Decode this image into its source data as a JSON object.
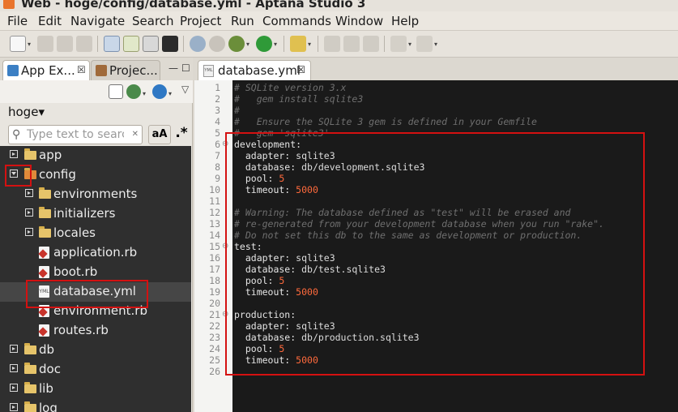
{
  "window": {
    "title": "Web - hoge/config/database.yml - Aptana Studio 3"
  },
  "menu": [
    {
      "label": "File"
    },
    {
      "label": "Edit"
    },
    {
      "label": "Navigate"
    },
    {
      "label": "Search"
    },
    {
      "label": "Project"
    },
    {
      "label": "Run"
    },
    {
      "label": "Commands"
    },
    {
      "label": "Window"
    },
    {
      "label": "Help"
    }
  ],
  "left_tabs": [
    {
      "label": "App Ex...",
      "close": "☒"
    },
    {
      "label": "Projec..."
    }
  ],
  "window_controls": {
    "minimize": "—",
    "maximize": "☐"
  },
  "project_selector": {
    "label": "hoge",
    "arrow": "▾"
  },
  "filter": {
    "placeholder": "Type text to search",
    "aa_label": "aA",
    "regex_label": ".*"
  },
  "tree": [
    {
      "label": "app",
      "type": "folder",
      "state": "collapsed",
      "level": 0
    },
    {
      "label": "config",
      "type": "folder",
      "state": "expanded",
      "level": 0
    },
    {
      "label": "environments",
      "type": "folder",
      "state": "collapsed",
      "level": 1
    },
    {
      "label": "initializers",
      "type": "folder",
      "state": "collapsed",
      "level": 1
    },
    {
      "label": "locales",
      "type": "folder",
      "state": "collapsed",
      "level": 1
    },
    {
      "label": "application.rb",
      "type": "ruby",
      "level": 1
    },
    {
      "label": "boot.rb",
      "type": "ruby",
      "level": 1
    },
    {
      "label": "database.yml",
      "type": "yaml",
      "level": 1,
      "selected": true
    },
    {
      "label": "environment.rb",
      "type": "ruby",
      "level": 1
    },
    {
      "label": "routes.rb",
      "type": "ruby",
      "level": 1
    },
    {
      "label": "db",
      "type": "folder",
      "state": "collapsed",
      "level": 0
    },
    {
      "label": "doc",
      "type": "folder",
      "state": "collapsed",
      "level": 0
    },
    {
      "label": "lib",
      "type": "folder",
      "state": "collapsed",
      "level": 0
    },
    {
      "label": "log",
      "type": "folder",
      "state": "collapsed",
      "level": 0
    }
  ],
  "editor": {
    "tab_label": "database.yml",
    "tab_close": "☒",
    "lines": [
      {
        "n": "1",
        "kind": "comment",
        "text": "# SQLite version 3.x"
      },
      {
        "n": "2",
        "kind": "comment",
        "text": "#   gem install sqlite3"
      },
      {
        "n": "3",
        "kind": "comment",
        "text": "#"
      },
      {
        "n": "4",
        "kind": "comment",
        "text": "#   Ensure the SQLite 3 gem is defined in your Gemfile"
      },
      {
        "n": "5",
        "kind": "comment",
        "text": "#   gem 'sqlite3'"
      },
      {
        "n": "6",
        "kind": "key",
        "text": "development:",
        "fold": "⊖"
      },
      {
        "n": "7",
        "kind": "pair",
        "key": "  adapter: ",
        "val": "sqlite3"
      },
      {
        "n": "8",
        "kind": "pair",
        "key": "  database: ",
        "val": "db/development.sqlite3"
      },
      {
        "n": "9",
        "kind": "num",
        "key": "  pool: ",
        "val": "5"
      },
      {
        "n": "10",
        "kind": "num",
        "key": "  timeout: ",
        "val": "5000"
      },
      {
        "n": "11",
        "kind": "blank",
        "text": ""
      },
      {
        "n": "12",
        "kind": "comment",
        "text": "# Warning: The database defined as \"test\" will be erased and"
      },
      {
        "n": "13",
        "kind": "comment",
        "text": "# re-generated from your development database when you run \"rake\"."
      },
      {
        "n": "14",
        "kind": "comment",
        "text": "# Do not set this db to the same as development or production."
      },
      {
        "n": "15",
        "kind": "key",
        "text": "test:",
        "fold": "⊖"
      },
      {
        "n": "16",
        "kind": "pair",
        "key": "  adapter: ",
        "val": "sqlite3"
      },
      {
        "n": "17",
        "kind": "pair",
        "key": "  database: ",
        "val": "db/test.sqlite3"
      },
      {
        "n": "18",
        "kind": "num",
        "key": "  pool: ",
        "val": "5"
      },
      {
        "n": "19",
        "kind": "num",
        "key": "  timeout: ",
        "val": "5000"
      },
      {
        "n": "20",
        "kind": "blank",
        "text": ""
      },
      {
        "n": "21",
        "kind": "key",
        "text": "production:",
        "fold": "⊖"
      },
      {
        "n": "22",
        "kind": "pair",
        "key": "  adapter: ",
        "val": "sqlite3"
      },
      {
        "n": "23",
        "kind": "pair",
        "key": "  database: ",
        "val": "db/production.sqlite3"
      },
      {
        "n": "24",
        "kind": "num",
        "key": "  pool: ",
        "val": "5"
      },
      {
        "n": "25",
        "kind": "num",
        "key": "  timeout: ",
        "val": "5000"
      },
      {
        "n": "26",
        "kind": "blank",
        "text": ""
      }
    ]
  },
  "colors": {
    "annotation_red": "#d41111",
    "comment": "#6f6f6f",
    "number": "#ff6a3c",
    "folder": "#e6c46a",
    "ruby": "#c8342c"
  }
}
